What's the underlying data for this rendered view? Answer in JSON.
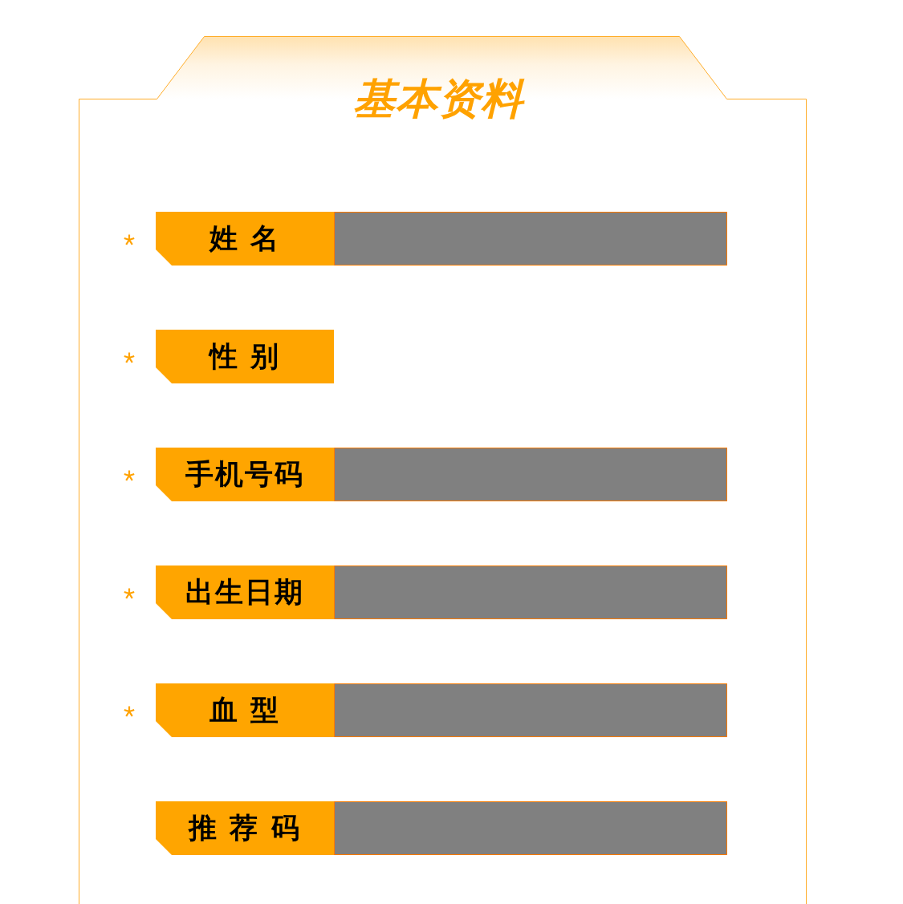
{
  "title": "基本资料",
  "fields": [
    {
      "label": "姓 名",
      "required": true,
      "kind": "text_input"
    },
    {
      "label": "性 别",
      "required": true,
      "kind": "label_only"
    },
    {
      "label": "手机号码",
      "required": true,
      "kind": "text_input"
    },
    {
      "label": "出生日期",
      "required": true,
      "kind": "text_input"
    },
    {
      "label": "血 型",
      "required": true,
      "kind": "text_input"
    },
    {
      "label": "推 荐 码",
      "required": false,
      "kind": "text_input"
    }
  ]
}
